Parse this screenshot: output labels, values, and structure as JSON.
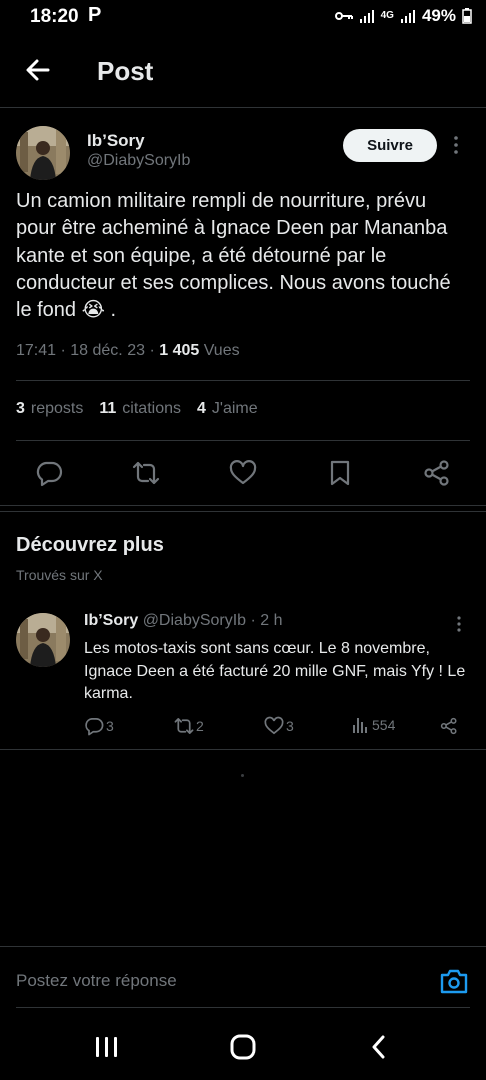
{
  "status_bar": {
    "time": "18:20",
    "p_icon": "P",
    "battery": "49%",
    "network": "4G"
  },
  "header": {
    "title": "Post"
  },
  "tweet": {
    "name": "Ib’Sory",
    "handle": "@DiabySoryIb",
    "follow_label": "Suivre",
    "text": "Un camion militaire rempli de nourriture, prévu pour être acheminé à Ignace Deen par Mananba kante et son équipe, a été détourné par le conducteur et ses complices. Nous avons touché le fond 😭 .",
    "time": "17:41",
    "date": "18 déc. 23",
    "views_count": "1 405",
    "views_label": "Vues",
    "reposts_count": "3",
    "reposts_label": "reposts",
    "quotes_count": "11",
    "quotes_label": "citations",
    "likes_count": "4",
    "likes_label": "J'aime"
  },
  "discover": {
    "title": "Découvrez plus",
    "subtitle": "Trouvés sur X",
    "card": {
      "name": "Ib’Sory",
      "handle": "@DiabySoryIb",
      "age": "· 2 h",
      "text": "Les motos-taxis sont sans cœur. Le 8 novembre, Ignace Deen a été facturé 20 mille GNF, mais Yfy ! Le karma.",
      "replies": "3",
      "reposts": "2",
      "likes": "3",
      "views": "554"
    }
  },
  "reply": {
    "placeholder": "Postez votre réponse"
  },
  "colors": {
    "background": "#000000",
    "text": "#e7e9ea",
    "muted": "#71767b",
    "accent": "#1d9bf0",
    "divider": "#2f3336"
  },
  "icons": [
    "back-arrow-icon",
    "reply-icon",
    "repost-icon",
    "like-icon",
    "bookmark-icon",
    "share-icon",
    "kebab-icon",
    "views-icon",
    "camera-icon",
    "recent-apps-icon",
    "home-icon",
    "back-icon"
  ]
}
